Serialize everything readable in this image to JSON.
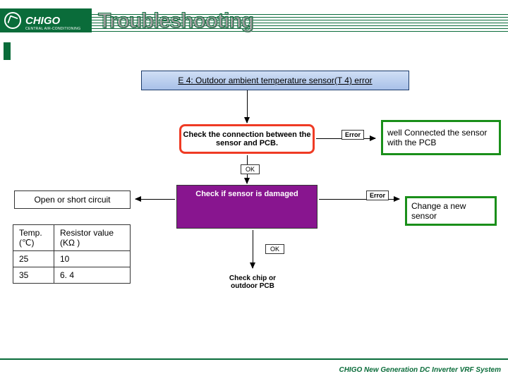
{
  "brand": {
    "name": "CHIGO",
    "sub": "CENTRAL AIR-CONDITIONING"
  },
  "title": "Troubleshooting",
  "footer": "CHIGO New Generation DC Inverter VRF System",
  "error": "E 4: Outdoor ambient temperature sensor(T 4) error",
  "steps": {
    "s1": "Check the connection between the sensor and PCB.",
    "s2": "Check if sensor is damaged",
    "s3": "Check chip or outdoor PCB"
  },
  "results": {
    "r1": "well Connected the sensor with the PCB",
    "r2": "Change a new sensor"
  },
  "labels": {
    "error": "Error",
    "ok": "OK"
  },
  "osc": "Open or short circuit",
  "table": {
    "headers": [
      "Temp. (℃)",
      "Resistor value (KΩ )"
    ],
    "rows": [
      [
        "25",
        "10"
      ],
      [
        "35",
        "6. 4"
      ]
    ]
  }
}
